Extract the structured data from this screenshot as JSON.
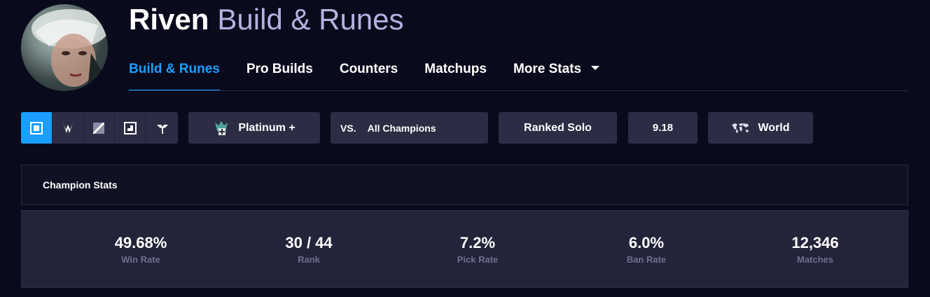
{
  "header": {
    "champion_name": "Riven",
    "title_suffix": "Build & Runes"
  },
  "nav": {
    "tabs": [
      {
        "label": "Build & Runes",
        "active": true
      },
      {
        "label": "Pro Builds"
      },
      {
        "label": "Counters"
      },
      {
        "label": "Matchups"
      },
      {
        "label": "More Stats",
        "dropdown": true
      }
    ]
  },
  "filters": {
    "roles": [
      {
        "icon": "top-lane-icon",
        "active": true
      },
      {
        "icon": "jungle-icon"
      },
      {
        "icon": "mid-lane-icon"
      },
      {
        "icon": "bot-lane-icon"
      },
      {
        "icon": "support-icon"
      }
    ],
    "rank": "Platinum +",
    "vs_prefix": "VS.",
    "vs_value": "All Champions",
    "queue": "Ranked Solo",
    "patch": "9.18",
    "region": "World"
  },
  "stats": {
    "section_title": "Champion Stats",
    "items": [
      {
        "value": "49.68%",
        "label": "Win Rate"
      },
      {
        "value": "30 / 44",
        "label": "Rank"
      },
      {
        "value": "7.2%",
        "label": "Pick Rate"
      },
      {
        "value": "6.0%",
        "label": "Ban Rate"
      },
      {
        "value": "12,346",
        "label": "Matches"
      }
    ]
  },
  "colors": {
    "background": "#0a0a1d",
    "accent": "#1a9fff",
    "panel": "#2c2d44",
    "title_suffix": "#b3b3e0"
  }
}
